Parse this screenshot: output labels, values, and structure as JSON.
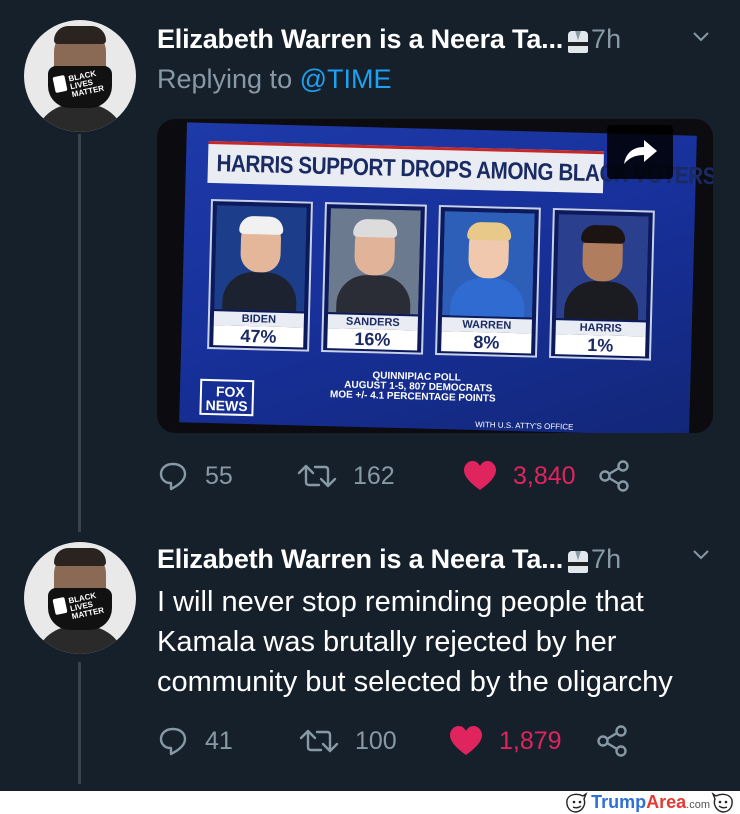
{
  "tweets": [
    {
      "display_name": "Elizabeth Warren is a Neera Ta...",
      "time": "7h",
      "reply_prefix": "Replying to ",
      "reply_handle": "@TIME",
      "media": {
        "headline": "HARRIS SUPPORT DROPS AMONG BLACK VOTERS",
        "candidates": [
          {
            "name": "BIDEN",
            "pct": "47%"
          },
          {
            "name": "SANDERS",
            "pct": "16%"
          },
          {
            "name": "WARREN",
            "pct": "8%"
          },
          {
            "name": "HARRIS",
            "pct": "1%"
          }
        ],
        "poll_lines": [
          "QUINNIPIAC POLL",
          "AUGUST 1-5, 807 DEMOCRATS",
          "MOE +/- 4.1 PERCENTAGE POINTS"
        ],
        "network_lines": [
          "FOX",
          "NEWS"
        ],
        "ticker": "WITH U.S. ATTY'S OFFICE"
      },
      "replies": "55",
      "retweets": "162",
      "likes": "3,840"
    },
    {
      "display_name": "Elizabeth Warren is a Neera Ta...",
      "time": "7h",
      "text": "I will never stop reminding people that Kamala was brutally rejected by her community but selected by the oligarchy",
      "replies": "41",
      "retweets": "100",
      "likes": "1,879"
    }
  ],
  "avatar_mask_text": [
    "BLACK",
    "LIVES",
    "MATTER"
  ],
  "watermark": {
    "trump": "Trump",
    "area": "Area",
    "dot": ".com"
  },
  "colors": {
    "background": "#15202b",
    "secondary_text": "#8899a6",
    "link": "#1da1f2",
    "like": "#e0245e",
    "thread_line": "#38444d"
  }
}
